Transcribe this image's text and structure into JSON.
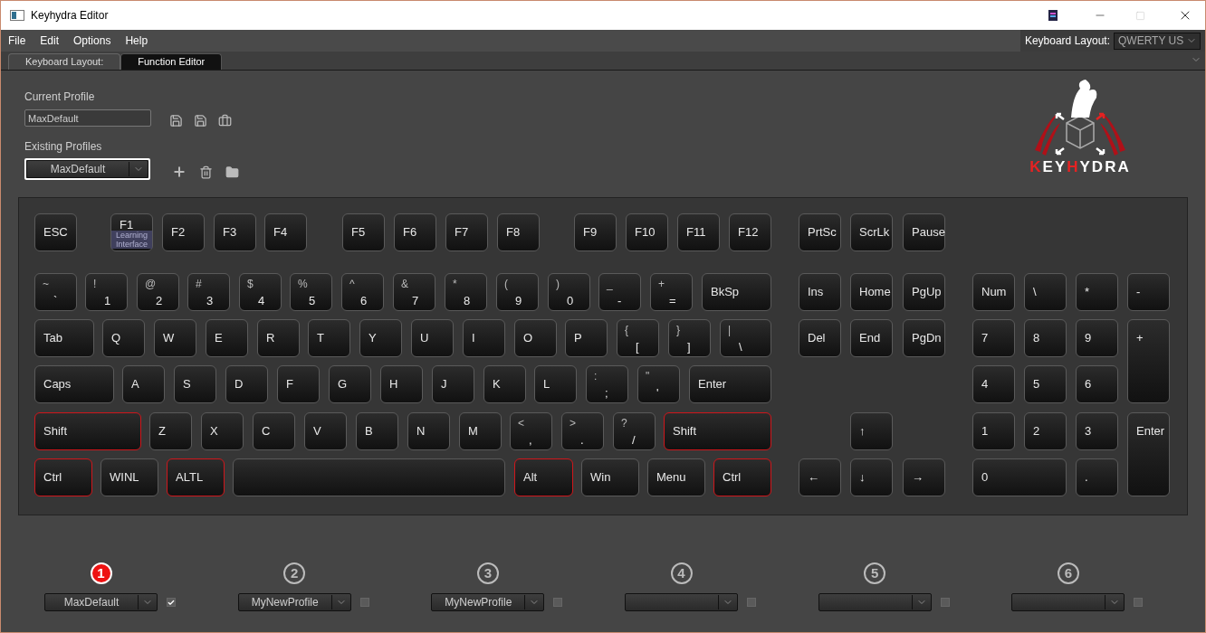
{
  "window": {
    "title": "Keyhydra Editor"
  },
  "menu": [
    "File",
    "Edit",
    "Options",
    "Help"
  ],
  "layout_selector": {
    "label": "Keyboard Layout:",
    "value": "QWERTY US"
  },
  "tabs": [
    {
      "label": "Keyboard Layout:",
      "selected": true
    },
    {
      "label": "Function Editor",
      "selected": false
    }
  ],
  "current_profile": {
    "label": "Current Profile",
    "value": "MaxDefault"
  },
  "existing_profiles": {
    "label": "Existing Profiles",
    "value": "MaxDefault"
  },
  "logo": {
    "text_a": "KEY",
    "text_b": "H",
    "text_c": "YDRA"
  },
  "keys": [
    {
      "label": "ESC",
      "highlighted": false
    },
    {
      "label": "F1",
      "highlighted": false,
      "tooltip": "Learning Interface"
    },
    {
      "label": "F2",
      "highlighted": false
    },
    {
      "label": "F3",
      "highlighted": false
    },
    {
      "label": "F4",
      "highlighted": false
    },
    {
      "label": "F5",
      "highlighted": false
    },
    {
      "label": "F6",
      "highlighted": false
    },
    {
      "label": "F7",
      "highlighted": false
    },
    {
      "label": "F8",
      "highlighted": false
    },
    {
      "label": "F9",
      "highlighted": false
    },
    {
      "label": "F10",
      "highlighted": false
    },
    {
      "label": "F11",
      "highlighted": false
    },
    {
      "label": "F12",
      "highlighted": false
    },
    {
      "label": "PrtSc",
      "highlighted": false
    },
    {
      "label": "ScrLk",
      "highlighted": false
    },
    {
      "label": "Pause",
      "highlighted": false
    },
    {
      "shift": "~",
      "label": "`",
      "highlighted": false
    },
    {
      "shift": "!",
      "label": "1",
      "highlighted": false
    },
    {
      "shift": "@",
      "label": "2",
      "highlighted": false
    },
    {
      "shift": "#",
      "label": "3",
      "highlighted": false
    },
    {
      "shift": "$",
      "label": "4",
      "highlighted": false
    },
    {
      "shift": "%",
      "label": "5",
      "highlighted": false
    },
    {
      "shift": "^",
      "label": "6",
      "highlighted": false
    },
    {
      "shift": "&",
      "label": "7",
      "highlighted": false
    },
    {
      "shift": "*",
      "label": "8",
      "highlighted": false
    },
    {
      "shift": "(",
      "label": "9",
      "highlighted": false
    },
    {
      "shift": ")",
      "label": "0",
      "highlighted": false
    },
    {
      "shift": "_",
      "label": "-",
      "highlighted": false
    },
    {
      "shift": "+",
      "label": "=",
      "highlighted": false
    },
    {
      "label": "BkSp",
      "highlighted": false
    },
    {
      "label": "Ins",
      "highlighted": false
    },
    {
      "label": "Home",
      "highlighted": false
    },
    {
      "label": "PgUp",
      "highlighted": false
    },
    {
      "label": "Num",
      "highlighted": false
    },
    {
      "label": "\\",
      "highlighted": false
    },
    {
      "label": "*",
      "highlighted": false
    },
    {
      "label": "-",
      "highlighted": false
    },
    {
      "label": "Tab",
      "highlighted": false
    },
    {
      "label": "Q",
      "highlighted": false
    },
    {
      "label": "W",
      "highlighted": false
    },
    {
      "label": "E",
      "highlighted": false
    },
    {
      "label": "R",
      "highlighted": false
    },
    {
      "label": "T",
      "highlighted": false
    },
    {
      "label": "Y",
      "highlighted": false
    },
    {
      "label": "U",
      "highlighted": false
    },
    {
      "label": "I",
      "highlighted": false
    },
    {
      "label": "O",
      "highlighted": false
    },
    {
      "label": "P",
      "highlighted": false
    },
    {
      "shift": "{",
      "label": "[",
      "highlighted": false
    },
    {
      "shift": "}",
      "label": "]",
      "highlighted": false
    },
    {
      "shift": "|",
      "label": "\\",
      "highlighted": false
    },
    {
      "label": "Del",
      "highlighted": false
    },
    {
      "label": "End",
      "highlighted": false
    },
    {
      "label": "PgDn",
      "highlighted": false
    },
    {
      "label": "7",
      "highlighted": false
    },
    {
      "label": "8",
      "highlighted": false
    },
    {
      "label": "9",
      "highlighted": false
    },
    {
      "label": "+",
      "highlighted": false
    },
    {
      "label": "Caps",
      "highlighted": false
    },
    {
      "label": "A",
      "highlighted": false
    },
    {
      "label": "S",
      "highlighted": false
    },
    {
      "label": "D",
      "highlighted": false
    },
    {
      "label": "F",
      "highlighted": false
    },
    {
      "label": "G",
      "highlighted": false
    },
    {
      "label": "H",
      "highlighted": false
    },
    {
      "label": "J",
      "highlighted": false
    },
    {
      "label": "K",
      "highlighted": false
    },
    {
      "label": "L",
      "highlighted": false
    },
    {
      "shift": ":",
      "label": ";",
      "highlighted": false
    },
    {
      "shift": "\"",
      "label": "'",
      "highlighted": false
    },
    {
      "label": "Enter",
      "highlighted": false
    },
    {
      "label": "4",
      "highlighted": false
    },
    {
      "label": "5",
      "highlighted": false
    },
    {
      "label": "6",
      "highlighted": false
    },
    {
      "label": "Shift",
      "highlighted": true
    },
    {
      "label": "Z",
      "highlighted": false
    },
    {
      "label": "X",
      "highlighted": false
    },
    {
      "label": "C",
      "highlighted": false
    },
    {
      "label": "V",
      "highlighted": false
    },
    {
      "label": "B",
      "highlighted": false
    },
    {
      "label": "N",
      "highlighted": false
    },
    {
      "label": "M",
      "highlighted": false
    },
    {
      "shift": "<",
      "label": ",",
      "highlighted": false
    },
    {
      "shift": ">",
      "label": ".",
      "highlighted": false
    },
    {
      "shift": "?",
      "label": "/",
      "highlighted": false
    },
    {
      "label": "Shift",
      "highlighted": true
    },
    {
      "label": "↑",
      "highlighted": false
    },
    {
      "label": "1",
      "highlighted": false
    },
    {
      "label": "2",
      "highlighted": false
    },
    {
      "label": "3",
      "highlighted": false
    },
    {
      "label": "Enter",
      "highlighted": false
    },
    {
      "label": "Ctrl",
      "highlighted": true
    },
    {
      "label": "WINL",
      "highlighted": false
    },
    {
      "label": "ALTL",
      "highlighted": true
    },
    {
      "highlighted": false
    },
    {
      "label": "Alt",
      "highlighted": true
    },
    {
      "label": "Win",
      "highlighted": false
    },
    {
      "label": "Menu",
      "highlighted": false
    },
    {
      "label": "Ctrl",
      "highlighted": true
    },
    {
      "label": "←",
      "highlighted": false
    },
    {
      "label": "↓",
      "highlighted": false
    },
    {
      "label": "→",
      "highlighted": false
    },
    {
      "label": "0",
      "highlighted": false
    },
    {
      "label": ".",
      "highlighted": false
    }
  ],
  "slots": [
    {
      "number": "1",
      "selected": true,
      "value": "MaxDefault",
      "checked": true
    },
    {
      "number": "2",
      "selected": false,
      "value": "MyNewProfile",
      "checked": false
    },
    {
      "number": "3",
      "selected": false,
      "value": "MyNewProfile",
      "checked": false
    },
    {
      "number": "4",
      "selected": false,
      "checked": false
    },
    {
      "number": "5",
      "selected": false,
      "checked": false
    },
    {
      "number": "6",
      "selected": false,
      "checked": false
    }
  ]
}
